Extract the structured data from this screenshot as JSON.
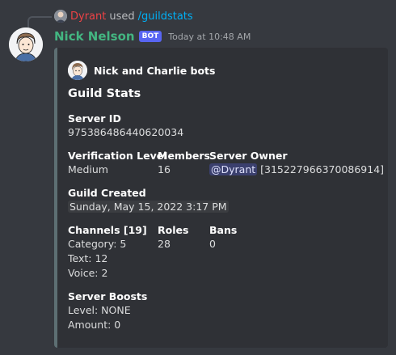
{
  "interaction": {
    "user": "Dyrant",
    "used_text": "used",
    "command": "/guildstats"
  },
  "message": {
    "username": "Nick Nelson",
    "bot_tag": "BOT",
    "timestamp": "Today at 10:48 AM"
  },
  "embed": {
    "author": "Nick and Charlie bots",
    "title": "Guild Stats",
    "accent_color": "#5d6f73",
    "server_id": {
      "name": "Server ID",
      "value": "975386486440620034"
    },
    "verification_level": {
      "name": "Verification Level",
      "value": "Medium"
    },
    "members": {
      "name": "Members",
      "value": "16"
    },
    "server_owner": {
      "name": "Server Owner",
      "mention": "@Dyrant",
      "id": "[315227966370086914]"
    },
    "guild_created": {
      "name": "Guild Created",
      "value": "Sunday, May 15, 2022 3:17 PM"
    },
    "channels": {
      "name": "Channels [19]",
      "category": "Category: 5",
      "text": "Text: 12",
      "voice": "Voice: 2"
    },
    "roles": {
      "name": "Roles",
      "value": "28"
    },
    "bans": {
      "name": "Bans",
      "value": "0"
    },
    "server_boosts": {
      "name": "Server Boosts",
      "level": "Level: NONE",
      "amount": "Amount: 0"
    }
  },
  "colors": {
    "background": "#36393f",
    "embed_background": "#2f3136",
    "username": "#43b581",
    "reply_user": "#ed4245",
    "command": "#00aff4",
    "bot_tag": "#5865f2"
  },
  "icons": {
    "reply": "reply-connector-icon",
    "mini_avatar": "user-avatar-icon",
    "avatar": "bot-avatar-icon",
    "author_icon": "author-avatar-icon"
  }
}
